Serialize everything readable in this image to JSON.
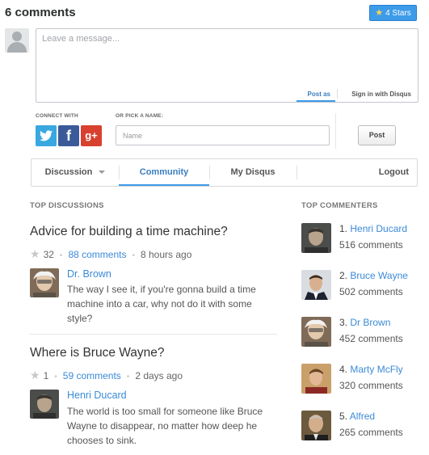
{
  "header": {
    "comments_count": "6 comments",
    "stars_label": "4 Stars"
  },
  "composer": {
    "placeholder": "Leave a message...",
    "post_as": "Post as",
    "sign_in": "Sign in with Disqus",
    "connect_with": "CONNECT WITH",
    "pick_name": "OR PICK A NAME:",
    "name_placeholder": "Name",
    "post_button": "Post"
  },
  "social": {
    "twitter": "t",
    "facebook": "f",
    "google": "g+"
  },
  "nav": {
    "discussion": "Discussion",
    "community": "Community",
    "my_disqus": "My Disqus",
    "logout": "Logout"
  },
  "top_discussions": {
    "title": "TOP DISCUSSIONS",
    "items": [
      {
        "title": "Advice for building a time machine?",
        "votes": "32",
        "comments": "88 comments",
        "time": "8 hours ago",
        "commenter": "Dr. Brown",
        "text": "The way I see it, if you're gonna build a time machine into a car, why not do it with some style?"
      },
      {
        "title": "Where is Bruce Wayne?",
        "votes": "1",
        "comments": "59 comments",
        "time": "2 days ago",
        "commenter": "Henri Ducard",
        "text": "The world is too small for someone like Bruce Wayne to disappear, no matter how deep he chooses to sink."
      }
    ]
  },
  "top_commenters": {
    "title": "TOP COMMENTERS",
    "items": [
      {
        "rank": "1.",
        "name": "Henri Ducard",
        "count": "516 comments"
      },
      {
        "rank": "2.",
        "name": "Bruce Wayne",
        "count": "502 comments"
      },
      {
        "rank": "3.",
        "name": "Dr Brown",
        "count": "452 comments"
      },
      {
        "rank": "4.",
        "name": "Marty McFly",
        "count": "320 comments"
      },
      {
        "rank": "5.",
        "name": "Alfred",
        "count": "265 comments"
      }
    ]
  },
  "colors": {
    "accent": "#3d9be9",
    "link": "#3b8ad8"
  }
}
